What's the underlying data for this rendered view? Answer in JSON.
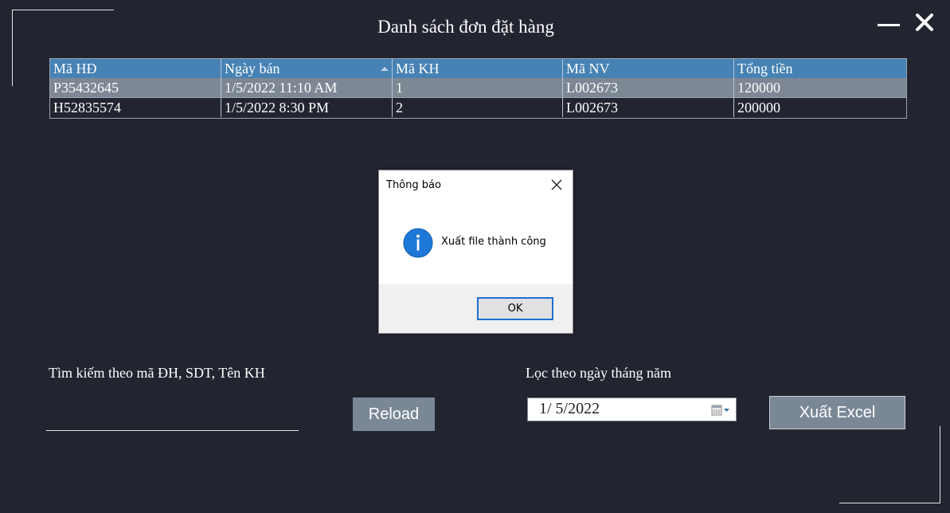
{
  "window": {
    "title": "Danh sách đơn đặt hàng"
  },
  "grid": {
    "columns": [
      "Mã HĐ",
      "Ngày bán",
      "Mã KH",
      "Mã NV",
      "Tổng tiền"
    ],
    "sorted_column": "Ngày bán",
    "rows": [
      {
        "ma_hd": "P35432645",
        "ngay_ban": "1/5/2022 11:10 AM",
        "ma_kh": "1",
        "ma_nv": "L002673",
        "tong_tien": "120000",
        "selected": true
      },
      {
        "ma_hd": "H52835574",
        "ngay_ban": "1/5/2022 8:30 PM",
        "ma_kh": "2",
        "ma_nv": "L002673",
        "tong_tien": "200000",
        "selected": false
      }
    ]
  },
  "search": {
    "label": "Tìm kiếm theo mã ĐH, SDT, Tên KH",
    "value": ""
  },
  "reload_label": "Reload",
  "date_filter": {
    "label": "Lọc theo ngày tháng năm",
    "value": "1/  5/2022"
  },
  "export_label": "Xuất Excel",
  "dialog": {
    "title": "Thông báo",
    "message": "Xuất file thành công",
    "ok_label": "OK",
    "icon": "info-icon"
  },
  "colors": {
    "background": "#222430",
    "grid_header": "#4682b4",
    "selected_row": "#7d8894",
    "button": "#7a8896",
    "info_blue": "#1e78d7"
  }
}
